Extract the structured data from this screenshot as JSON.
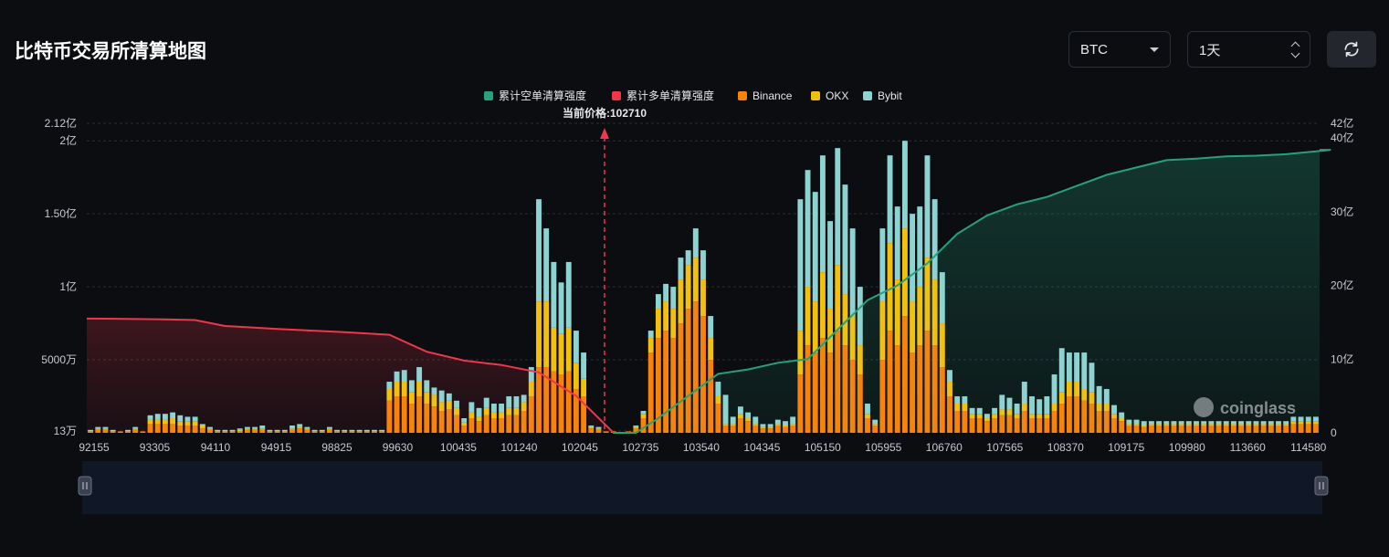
{
  "page": {
    "title": "比特币交易所清算地图"
  },
  "controls": {
    "coin": "BTC",
    "range": "1天"
  },
  "icons": {
    "refresh": "refresh-icon",
    "coin_dropdown": "chevron-down-icon",
    "range_stepper": "up-down-icon"
  },
  "watermark": "coinglass",
  "colors": {
    "short_cum": "#26a17b",
    "long_cum": "#f0364a",
    "binance": "#f7820c",
    "okx": "#f2c10f",
    "bybit": "#8dd3d2",
    "grid": "#2a2e36"
  },
  "chart_data": {
    "type": "bar",
    "stacked": true,
    "current_price_label": "当前价格:102710",
    "current_price": 102710,
    "legend": [
      "累计空单清算强度",
      "累计多单清算强度",
      "Binance",
      "OKX",
      "Bybit"
    ],
    "legend_position": "top-center",
    "x_tick_labels": [
      "92155",
      "93305",
      "94110",
      "94915",
      "98825",
      "99630",
      "100435",
      "101240",
      "102045",
      "102735",
      "103540",
      "104345",
      "105150",
      "105955",
      "106760",
      "107565",
      "108370",
      "109175",
      "109980",
      "113660",
      "114580"
    ],
    "y_left_ticks": [
      {
        "value": 1300000,
        "label": "13万"
      },
      {
        "value": 50000000,
        "label": "5000万"
      },
      {
        "value": 100000000,
        "label": "1亿"
      },
      {
        "value": 150000000,
        "label": "1.50亿"
      },
      {
        "value": 200000000,
        "label": "2亿"
      },
      {
        "value": 212000000,
        "label": "2.12亿"
      }
    ],
    "y_right_ticks": [
      {
        "value": 0,
        "label": "0"
      },
      {
        "value": 1000000000,
        "label": "10亿"
      },
      {
        "value": 2000000000,
        "label": "20亿"
      },
      {
        "value": 3000000000,
        "label": "30亿"
      },
      {
        "value": 4000000000,
        "label": "40亿"
      },
      {
        "value": 4200000000,
        "label": "42亿"
      }
    ],
    "ylim_left": [
      1300000,
      212000000
    ],
    "ylim_right": [
      0,
      4200000000
    ],
    "current_price_index": 69,
    "series": [
      {
        "name": "Binance",
        "values": [
          1,
          2,
          2,
          1,
          1,
          1,
          2,
          1,
          6,
          6,
          6,
          6,
          5,
          5,
          5,
          3,
          2,
          1,
          1,
          1,
          1,
          2,
          2,
          2,
          1,
          1,
          1,
          2,
          3,
          2,
          1,
          1,
          2,
          1,
          1,
          1,
          1,
          1,
          1,
          1,
          22,
          25,
          25,
          20,
          25,
          20,
          18,
          15,
          16,
          12,
          5,
          10,
          8,
          12,
          10,
          10,
          12,
          12,
          15,
          25,
          45,
          45,
          42,
          40,
          42,
          30,
          25,
          3,
          2,
          1,
          1,
          0,
          1,
          3,
          10,
          55,
          65,
          70,
          65,
          75,
          85,
          90,
          80,
          50,
          20,
          5,
          5,
          10,
          8,
          5,
          3,
          3,
          5,
          4,
          5,
          40,
          60,
          55,
          65,
          55,
          70,
          60,
          50,
          40,
          10,
          5,
          50,
          70,
          60,
          80,
          55,
          60,
          70,
          60,
          45,
          25,
          15,
          15,
          10,
          10,
          8,
          10,
          12,
          12,
          10,
          15,
          10,
          10,
          10,
          15,
          20,
          25,
          25,
          22,
          20,
          15,
          15,
          10,
          8,
          5,
          5,
          4,
          5,
          5,
          5,
          5,
          5,
          5,
          5,
          5,
          5,
          5,
          5,
          5,
          5,
          5,
          5,
          5,
          5,
          5,
          5,
          6,
          6,
          6,
          6
        ]
      },
      {
        "name": "OKX",
        "values": [
          0,
          1,
          1,
          0,
          0,
          0,
          1,
          0,
          3,
          3,
          3,
          4,
          3,
          3,
          3,
          2,
          1,
          0,
          0,
          0,
          1,
          1,
          1,
          1,
          0,
          0,
          0,
          1,
          1,
          1,
          0,
          0,
          1,
          0,
          0,
          0,
          0,
          0,
          0,
          0,
          8,
          10,
          10,
          8,
          10,
          8,
          8,
          6,
          6,
          5,
          2,
          4,
          3,
          5,
          4,
          4,
          5,
          5,
          6,
          10,
          45,
          45,
          30,
          28,
          30,
          18,
          12,
          1,
          1,
          0,
          0,
          0,
          0,
          1,
          3,
          10,
          20,
          20,
          20,
          30,
          30,
          30,
          25,
          15,
          5,
          1,
          1,
          3,
          2,
          1,
          1,
          1,
          1,
          1,
          1,
          30,
          40,
          35,
          45,
          30,
          45,
          35,
          30,
          20,
          3,
          1,
          40,
          60,
          45,
          60,
          35,
          40,
          50,
          45,
          30,
          10,
          5,
          5,
          3,
          3,
          2,
          3,
          4,
          4,
          3,
          5,
          3,
          3,
          3,
          5,
          8,
          10,
          10,
          8,
          8,
          5,
          5,
          3,
          2,
          1,
          1,
          1,
          1,
          1,
          1,
          1,
          1,
          1,
          1,
          1,
          1,
          1,
          1,
          1,
          1,
          1,
          1,
          1,
          1,
          1,
          1,
          2,
          2,
          2,
          2
        ]
      },
      {
        "name": "Bybit",
        "values": [
          1,
          1,
          1,
          1,
          0,
          1,
          1,
          0,
          3,
          4,
          4,
          4,
          4,
          3,
          3,
          1,
          1,
          1,
          1,
          1,
          1,
          1,
          1,
          2,
          1,
          1,
          1,
          2,
          2,
          1,
          1,
          1,
          1,
          1,
          1,
          1,
          1,
          1,
          1,
          1,
          5,
          7,
          8,
          8,
          10,
          8,
          5,
          8,
          5,
          5,
          3,
          7,
          6,
          7,
          6,
          6,
          8,
          8,
          5,
          10,
          70,
          50,
          45,
          35,
          45,
          22,
          18,
          1,
          1,
          0,
          0,
          0,
          0,
          1,
          2,
          5,
          10,
          12,
          15,
          15,
          10,
          20,
          20,
          15,
          10,
          20,
          5,
          5,
          4,
          5,
          2,
          2,
          3,
          3,
          5,
          90,
          80,
          75,
          80,
          60,
          80,
          75,
          60,
          40,
          7,
          3,
          50,
          60,
          50,
          60,
          60,
          55,
          70,
          55,
          35,
          8,
          5,
          5,
          4,
          4,
          3,
          4,
          10,
          8,
          7,
          15,
          12,
          10,
          12,
          20,
          30,
          20,
          20,
          25,
          20,
          12,
          10,
          6,
          4,
          3,
          3,
          3,
          2,
          2,
          2,
          2,
          2,
          2,
          2,
          2,
          2,
          2,
          2,
          2,
          2,
          2,
          2,
          2,
          2,
          2,
          2,
          3,
          3,
          3,
          3
        ]
      }
    ],
    "cum_long_points": [
      [
        0,
        15.5
      ],
      [
        10,
        15.4
      ],
      [
        14,
        15.3
      ],
      [
        18,
        14.5
      ],
      [
        25,
        14.1
      ],
      [
        35,
        13.6
      ],
      [
        40,
        13.3
      ],
      [
        45,
        11
      ],
      [
        50,
        9.8
      ],
      [
        55,
        9.2
      ],
      [
        60,
        8.2
      ],
      [
        65,
        5
      ],
      [
        70,
        0
      ],
      [
        72,
        0
      ]
    ],
    "cum_short_points": [
      [
        70,
        0
      ],
      [
        73,
        0
      ],
      [
        76,
        2
      ],
      [
        80,
        5
      ],
      [
        84,
        8
      ],
      [
        88,
        8.6
      ],
      [
        92,
        9.5
      ],
      [
        96,
        10
      ],
      [
        100,
        14
      ],
      [
        104,
        18
      ],
      [
        108,
        20
      ],
      [
        112,
        23
      ],
      [
        116,
        27
      ],
      [
        120,
        29.5
      ],
      [
        124,
        31
      ],
      [
        128,
        32
      ],
      [
        132,
        33.5
      ],
      [
        136,
        35
      ],
      [
        140,
        36
      ],
      [
        144,
        37
      ],
      [
        148,
        37.2
      ],
      [
        152,
        37.5
      ],
      [
        156,
        37.6
      ],
      [
        160,
        37.8
      ],
      [
        164,
        38.2
      ],
      [
        166,
        38.4
      ]
    ],
    "cum_unit": "亿"
  }
}
